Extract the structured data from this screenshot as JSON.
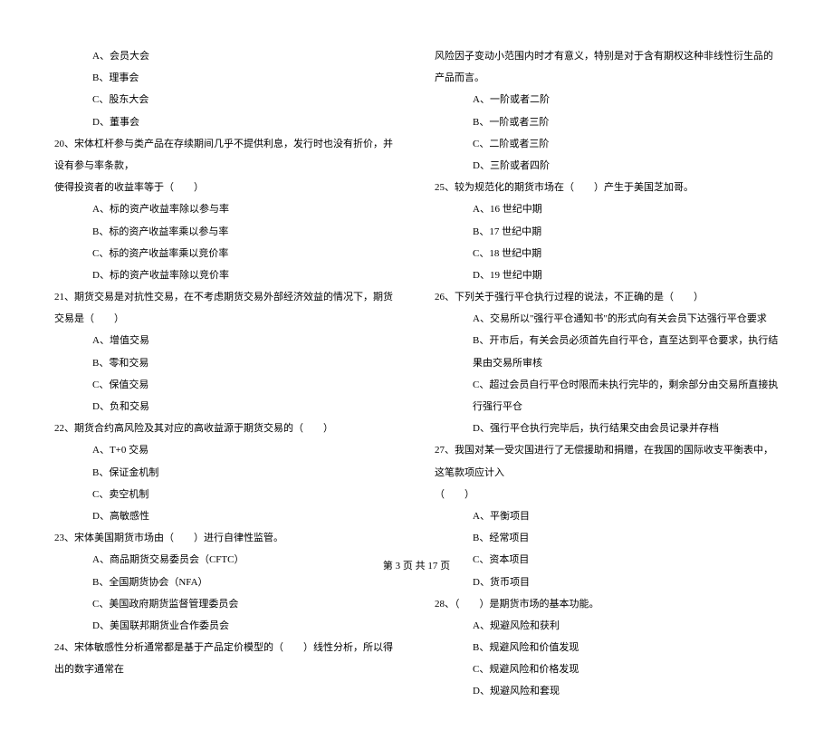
{
  "left": [
    {
      "cls": "indent-2",
      "text": "A、会员大会"
    },
    {
      "cls": "indent-2",
      "text": "B、理事会"
    },
    {
      "cls": "indent-2",
      "text": "C、股东大会"
    },
    {
      "cls": "indent-2",
      "text": "D、董事会"
    },
    {
      "cls": "q-line",
      "text": "20、宋体杠杆参与类产品在存续期间几乎不提供利息，发行时也没有折价，并设有参与率条款，"
    },
    {
      "cls": "q-line",
      "text": "使得投资者的收益率等于（　　）"
    },
    {
      "cls": "indent-2",
      "text": "A、标的资产收益率除以参与率"
    },
    {
      "cls": "indent-2",
      "text": "B、标的资产收益率乘以参与率"
    },
    {
      "cls": "indent-2",
      "text": "C、标的资产收益率乘以竞价率"
    },
    {
      "cls": "indent-2",
      "text": "D、标的资产收益率除以竞价率"
    },
    {
      "cls": "q-line",
      "text": "21、期货交易是对抗性交易，在不考虑期货交易外部经济效益的情况下，期货交易是（　　）"
    },
    {
      "cls": "indent-2",
      "text": "A、增值交易"
    },
    {
      "cls": "indent-2",
      "text": "B、零和交易"
    },
    {
      "cls": "indent-2",
      "text": "C、保值交易"
    },
    {
      "cls": "indent-2",
      "text": "D、负和交易"
    },
    {
      "cls": "q-line",
      "text": "22、期货合约高风险及其对应的高收益源于期货交易的（　　）"
    },
    {
      "cls": "indent-2",
      "text": "A、T+0 交易"
    },
    {
      "cls": "indent-2",
      "text": "B、保证金机制"
    },
    {
      "cls": "indent-2",
      "text": "C、卖空机制"
    },
    {
      "cls": "indent-2",
      "text": "D、高敏感性"
    },
    {
      "cls": "q-line",
      "text": "23、宋体美国期货市场由（　　）进行自律性监管。"
    },
    {
      "cls": "indent-2",
      "text": "A、商品期货交易委员会（CFTC）"
    },
    {
      "cls": "indent-2",
      "text": "B、全国期货协会（NFA）"
    },
    {
      "cls": "indent-2",
      "text": "C、美国政府期货监督管理委员会"
    },
    {
      "cls": "indent-2",
      "text": "D、美国联邦期货业合作委员会"
    },
    {
      "cls": "q-line",
      "text": "24、宋体敏感性分析通常都是基于产品定价模型的（　　）线性分析，所以得出的数字通常在"
    }
  ],
  "right": [
    {
      "cls": "q-line",
      "text": "风险因子变动小范围内时才有意义，特别是对于含有期权这种非线性衍生品的产品而言。"
    },
    {
      "cls": "indent-2",
      "text": "A、一阶或者二阶"
    },
    {
      "cls": "indent-2",
      "text": "B、一阶或者三阶"
    },
    {
      "cls": "indent-2",
      "text": "C、二阶或者三阶"
    },
    {
      "cls": "indent-2",
      "text": "D、三阶或者四阶"
    },
    {
      "cls": "q-line",
      "text": "25、较为规范化的期货市场在（　　）产生于美国芝加哥。"
    },
    {
      "cls": "indent-2",
      "text": "A、16 世纪中期"
    },
    {
      "cls": "indent-2",
      "text": "B、17 世纪中期"
    },
    {
      "cls": "indent-2",
      "text": "C、18 世纪中期"
    },
    {
      "cls": "indent-2",
      "text": "D、19 世纪中期"
    },
    {
      "cls": "q-line",
      "text": "26、下列关于强行平仓执行过程的说法，不正确的是（　　）"
    },
    {
      "cls": "indent-2",
      "text": "A、交易所以\"强行平仓通知书\"的形式向有关会员下达强行平仓要求"
    },
    {
      "cls": "indent-2",
      "text": "B、开市后，有关会员必须首先自行平仓，直至达到平仓要求，执行结果由交易所审核"
    },
    {
      "cls": "indent-2",
      "text": "C、超过会员自行平仓时限而未执行完毕的，剩余部分由交易所直接执行强行平仓"
    },
    {
      "cls": "indent-2",
      "text": "D、强行平仓执行完毕后，执行结果交由会员记录并存档"
    },
    {
      "cls": "q-line",
      "text": "27、我国对某一受灾国进行了无偿援助和捐赠，在我国的国际收支平衡表中，这笔款项应计入"
    },
    {
      "cls": "q-line",
      "text": "（　　）"
    },
    {
      "cls": "indent-2",
      "text": "A、平衡项目"
    },
    {
      "cls": "indent-2",
      "text": "B、经常项目"
    },
    {
      "cls": "indent-2",
      "text": "C、资本项目"
    },
    {
      "cls": "indent-2",
      "text": "D、货币项目"
    },
    {
      "cls": "q-line",
      "text": "28、（　　）是期货市场的基本功能。"
    },
    {
      "cls": "indent-2",
      "text": "A、规避风险和获利"
    },
    {
      "cls": "indent-2",
      "text": "B、规避风险和价值发现"
    },
    {
      "cls": "indent-2",
      "text": "C、规避风险和价格发现"
    },
    {
      "cls": "indent-2",
      "text": "D、规避风险和套现"
    }
  ],
  "footer": "第 3 页 共 17 页"
}
